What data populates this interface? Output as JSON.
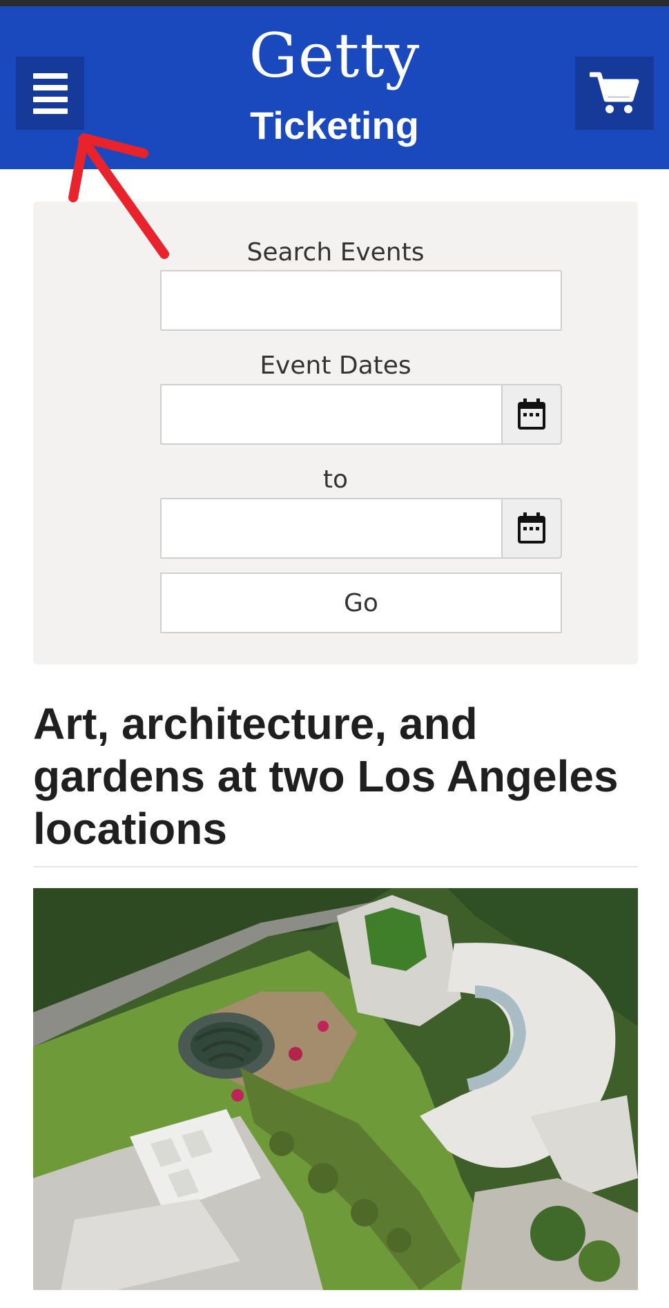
{
  "header": {
    "logo": "Getty",
    "subtitle": "Ticketing",
    "bg_color": "#1a49bd",
    "menu_icon": "hamburger-menu-icon",
    "cart_icon": "shopping-cart-icon"
  },
  "search": {
    "search_label": "Search Events",
    "search_value": "",
    "dates_label": "Event Dates",
    "start_date_value": "",
    "to_label": "to",
    "end_date_value": "",
    "calendar_icon": "calendar-icon",
    "go_label": "Go"
  },
  "main": {
    "headline": "Art, architecture, and gardens at two Los Angeles locations",
    "hero_image": "aerial view of the Getty Center campus with gardens and buildings"
  },
  "annotation": {
    "arrow_icon": "red-arrow-icon",
    "arrow_color": "#e8232c"
  }
}
